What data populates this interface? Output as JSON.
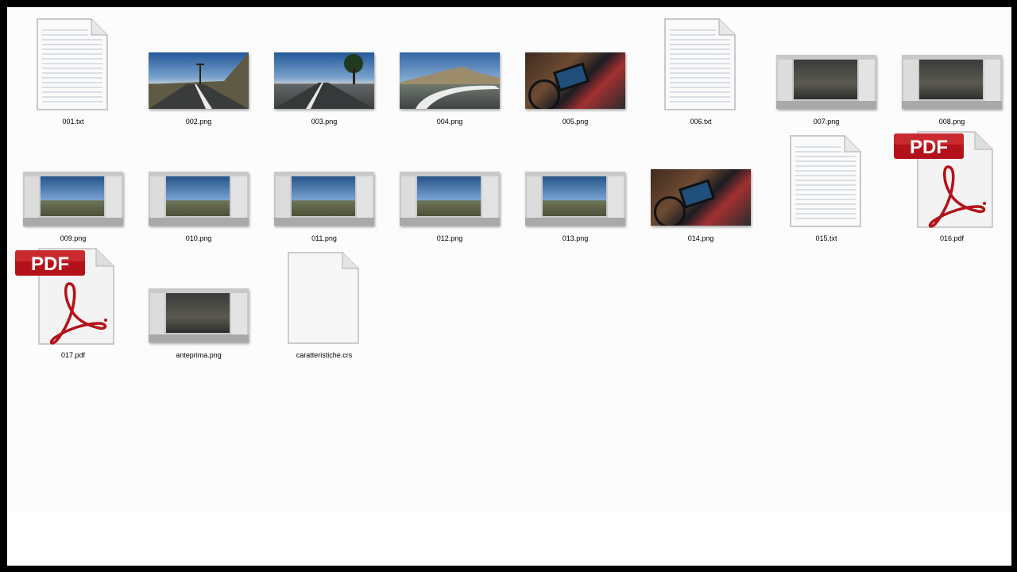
{
  "files": [
    {
      "id": "f001",
      "name": "001.txt",
      "kind": "txt"
    },
    {
      "id": "f002",
      "name": "002.png",
      "kind": "road"
    },
    {
      "id": "f003",
      "name": "003.png",
      "kind": "road"
    },
    {
      "id": "f004",
      "name": "004.png",
      "kind": "mountain"
    },
    {
      "id": "f005",
      "name": "005.png",
      "kind": "bike"
    },
    {
      "id": "f006",
      "name": "006.txt",
      "kind": "txt"
    },
    {
      "id": "f007",
      "name": "007.png",
      "kind": "editor-dark"
    },
    {
      "id": "f008",
      "name": "008.png",
      "kind": "editor-dark"
    },
    {
      "id": "f009",
      "name": "009.png",
      "kind": "editor"
    },
    {
      "id": "f010",
      "name": "010.png",
      "kind": "editor"
    },
    {
      "id": "f011",
      "name": "011.png",
      "kind": "editor"
    },
    {
      "id": "f012",
      "name": "012.png",
      "kind": "editor"
    },
    {
      "id": "f013",
      "name": "013.png",
      "kind": "editor"
    },
    {
      "id": "f014",
      "name": "014.png",
      "kind": "bike"
    },
    {
      "id": "f015",
      "name": "015.txt",
      "kind": "txt"
    },
    {
      "id": "f016",
      "name": "016.pdf",
      "kind": "pdf"
    },
    {
      "id": "f017",
      "name": "017.pdf",
      "kind": "pdf"
    },
    {
      "id": "fant",
      "name": "anteprima.png",
      "kind": "editor-dark"
    },
    {
      "id": "fcrs",
      "name": "caratteristiche.crs",
      "kind": "blank"
    }
  ],
  "pdf_badge_text": "PDF",
  "colors": {
    "pdf_red": "#b4121a",
    "background": "#fcfcfc",
    "frame": "#000000"
  }
}
